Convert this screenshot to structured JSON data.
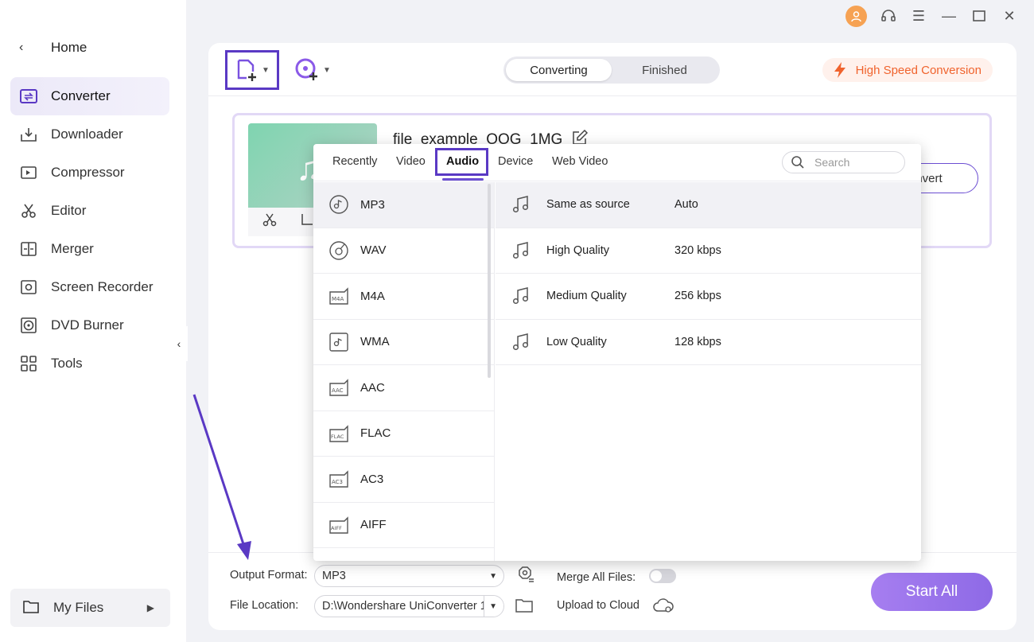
{
  "sidebar": {
    "home": "Home",
    "items": [
      {
        "label": "Converter",
        "icon": "converter-icon"
      },
      {
        "label": "Downloader",
        "icon": "downloader-icon"
      },
      {
        "label": "Compressor",
        "icon": "compressor-icon"
      },
      {
        "label": "Editor",
        "icon": "scissors-icon"
      },
      {
        "label": "Merger",
        "icon": "merger-icon"
      },
      {
        "label": "Screen Recorder",
        "icon": "screen-recorder-icon"
      },
      {
        "label": "DVD Burner",
        "icon": "dvd-icon"
      },
      {
        "label": "Tools",
        "icon": "tools-grid-icon"
      }
    ],
    "my_files": "My Files"
  },
  "toolbar": {
    "tabs": [
      "Converting",
      "Finished"
    ],
    "high_speed": "High Speed Conversion"
  },
  "file": {
    "name": "file_example_OOG_1MG",
    "convert_label": "nvert"
  },
  "popup": {
    "tabs": [
      "Recently",
      "Video",
      "Audio",
      "Device",
      "Web Video"
    ],
    "active_tab": "Audio",
    "search_placeholder": "Search",
    "formats": [
      "MP3",
      "WAV",
      "M4A",
      "WMA",
      "AAC",
      "FLAC",
      "AC3",
      "AIFF"
    ],
    "qualities": [
      {
        "name": "Same as source",
        "bitrate": "Auto"
      },
      {
        "name": "High Quality",
        "bitrate": "320 kbps"
      },
      {
        "name": "Medium Quality",
        "bitrate": "256 kbps"
      },
      {
        "name": "Low Quality",
        "bitrate": "128 kbps"
      }
    ]
  },
  "bottom": {
    "output_format_label": "Output Format:",
    "output_format_value": "MP3",
    "merge_label": "Merge All Files:",
    "file_location_label": "File Location:",
    "file_location_value": "D:\\Wondershare UniConverter 1",
    "upload_label": "Upload to Cloud",
    "start_all": "Start All"
  },
  "colors": {
    "accent": "#5a39c4",
    "start_button": "#9b76ec",
    "high_speed": "#f0632d"
  }
}
